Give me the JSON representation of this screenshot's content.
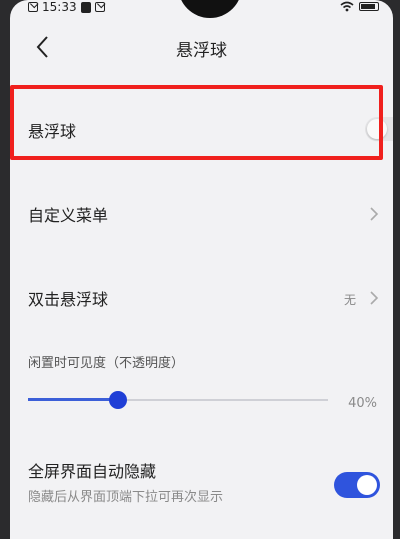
{
  "status_bar": {
    "time": "15:33"
  },
  "header": {
    "title": "悬浮球"
  },
  "floating_ball": {
    "label": "悬浮球",
    "enabled": false
  },
  "custom_menu": {
    "label": "自定义菜单"
  },
  "double_click": {
    "label": "双击悬浮球",
    "value": "无"
  },
  "idle_visibility": {
    "label": "闲置时可见度（不透明度）",
    "value_text": "40%",
    "fraction": 0.3
  },
  "fullscreen_hide": {
    "label": "全屏界面自动隐藏",
    "description": "隐藏后从界面顶端下拉可再次显示",
    "enabled": true
  },
  "colors": {
    "accent": "#2f54dd",
    "highlight": "#f0201d"
  }
}
